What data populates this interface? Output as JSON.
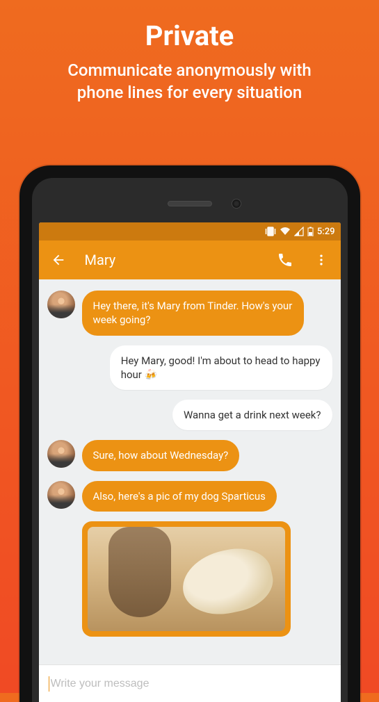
{
  "promo": {
    "title": "Private",
    "subtitle_line1": "Communicate anonymously with",
    "subtitle_line2": "phone lines for every situation"
  },
  "statusbar": {
    "time": "5:29"
  },
  "appbar": {
    "title": "Mary"
  },
  "messages": {
    "m0": "Hey there, it's Mary from Tinder. How's your week going?",
    "m1": "Hey Mary, good! I'm about to head to happy hour 🍻",
    "m2": "Wanna get a drink next week?",
    "m3": "Sure, how about Wednesday?",
    "m4": "Also, here's a pic of my dog Sparticus"
  },
  "composer": {
    "placeholder": "Write your message"
  }
}
